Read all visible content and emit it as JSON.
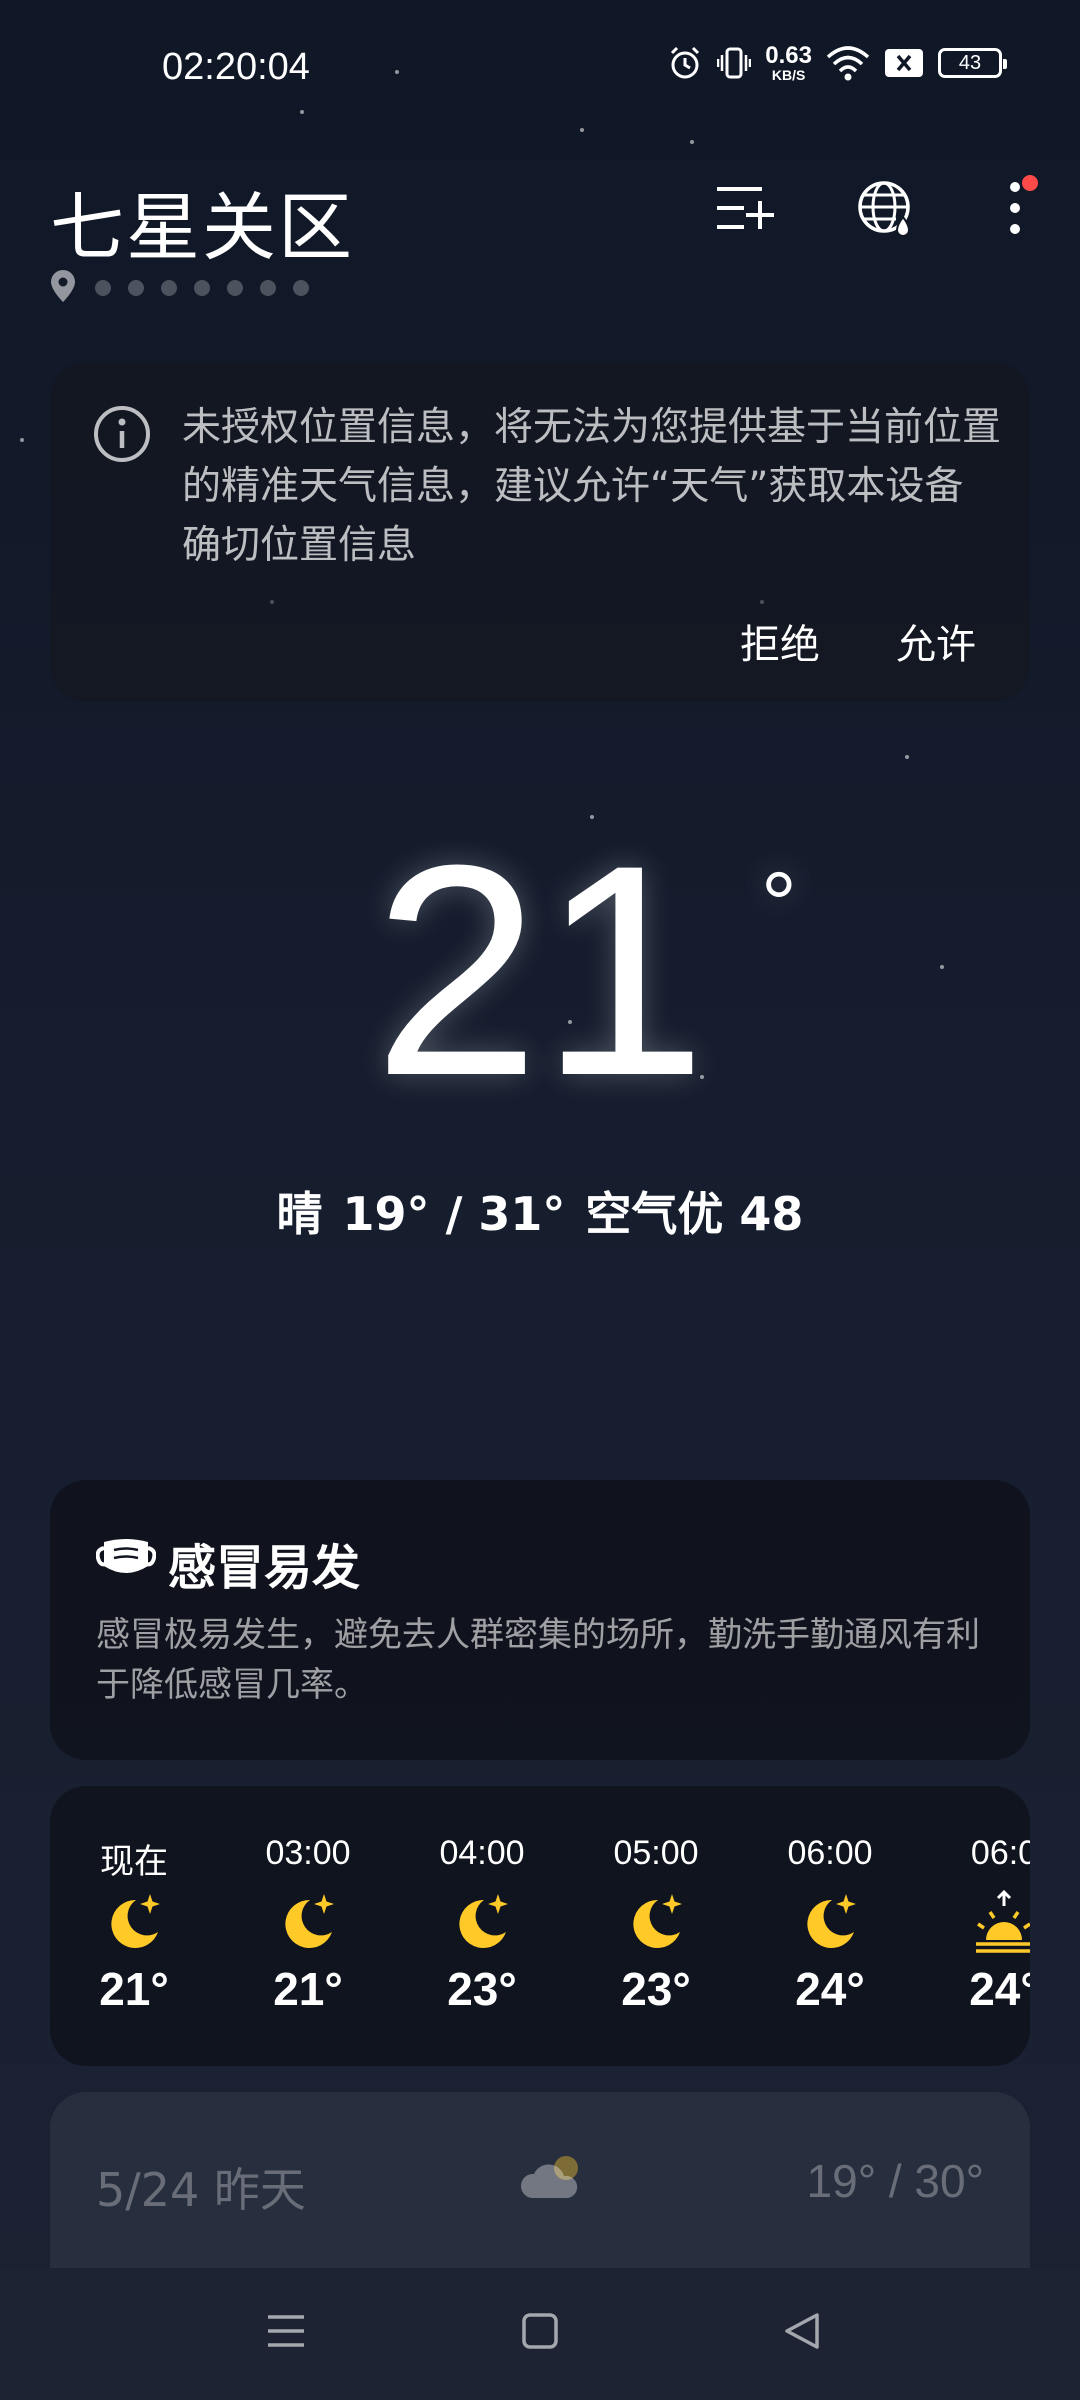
{
  "status_bar": {
    "time": "02:20:04",
    "net_speed_value": "0.63",
    "net_speed_unit": "KB/S",
    "battery": "43",
    "icons": [
      "alarm-icon",
      "vibrate-icon",
      "wifi-icon",
      "sim-blocked-icon",
      "battery-icon"
    ]
  },
  "header": {
    "city": "七星关区",
    "actions": [
      "add-city-icon",
      "globe-rain-icon",
      "more-icon"
    ],
    "page_dots": 7
  },
  "permission": {
    "text": "未授权位置信息，将无法为您提供基于当前位置的精准天气信息，建议允许“天气”获取本设备确切位置信息",
    "deny": "拒绝",
    "allow": "允许"
  },
  "current": {
    "temp": "21",
    "degree": "°",
    "condition": "晴",
    "range": "19° / 31°",
    "aqi": "空气优 48"
  },
  "cold": {
    "title": "感冒易发",
    "desc": "感冒极易发生，避免去人群密集的场所，勤洗手勤通风有利于降低感冒几率。"
  },
  "hourly": [
    {
      "label": "现在",
      "temp": "21°",
      "icon": "moon-icon"
    },
    {
      "label": "03:00",
      "temp": "21°",
      "icon": "moon-icon"
    },
    {
      "label": "04:00",
      "temp": "23°",
      "icon": "moon-icon"
    },
    {
      "label": "05:00",
      "temp": "23°",
      "icon": "moon-icon"
    },
    {
      "label": "06:00",
      "temp": "24°",
      "icon": "moon-icon"
    },
    {
      "label": "06:0",
      "temp": "24°",
      "icon": "sunrise-icon"
    }
  ],
  "daily": [
    {
      "date": "5/24 昨天",
      "range": "19° / 30°",
      "icon": "cloudy-night-icon"
    }
  ],
  "colors": {
    "moon": "#ffca28",
    "accent_red": "#ff4a4a"
  },
  "nav": [
    "menu-icon",
    "home-icon",
    "back-icon"
  ]
}
